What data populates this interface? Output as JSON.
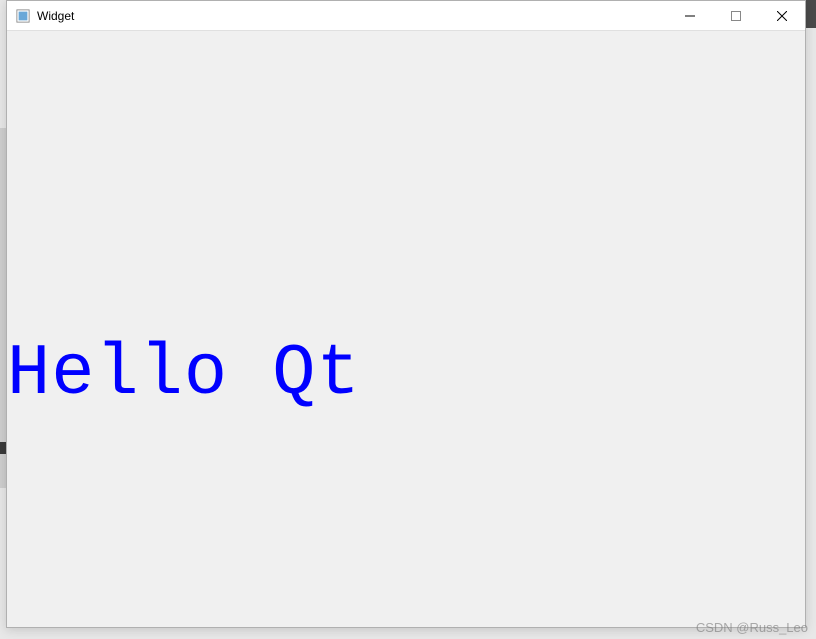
{
  "window": {
    "title": "Widget"
  },
  "content": {
    "label_text": "Hello Qt"
  },
  "watermark": {
    "text": "CSDN @Russ_Leo"
  }
}
